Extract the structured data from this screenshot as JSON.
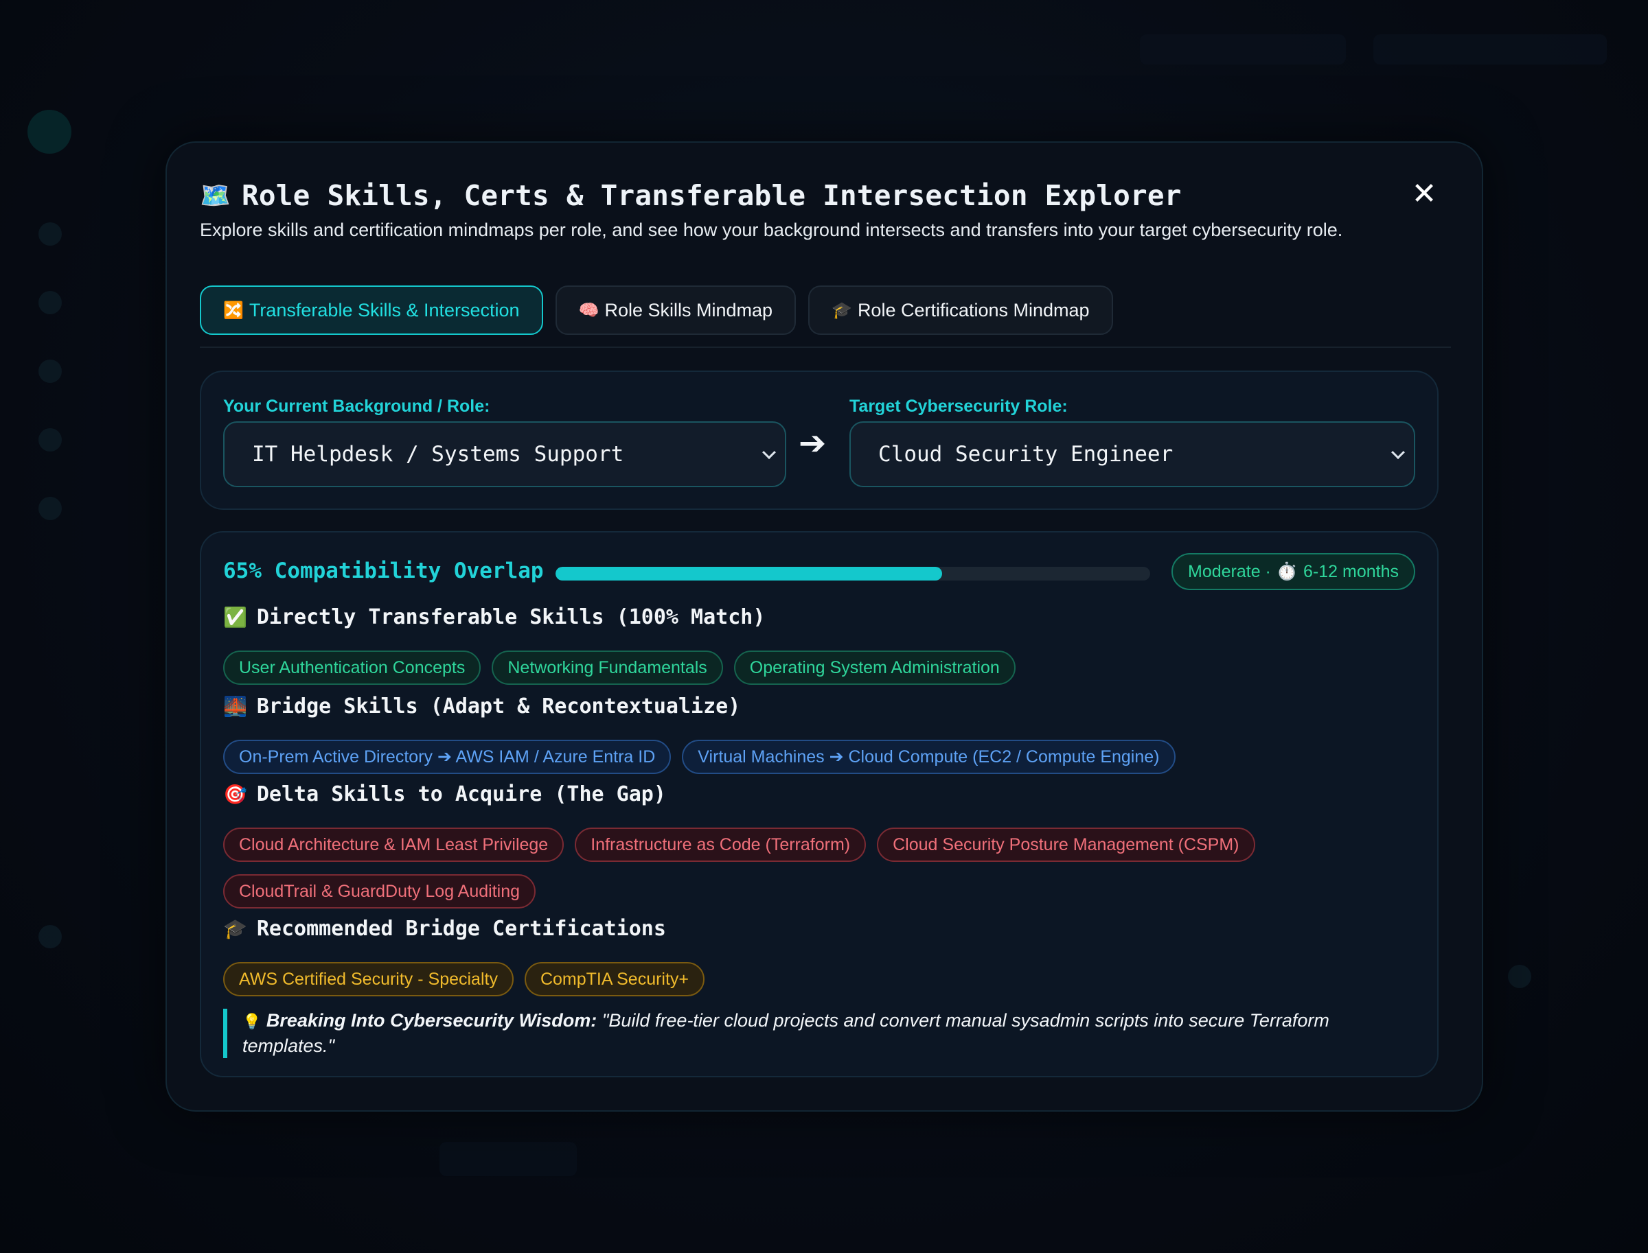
{
  "modal": {
    "title_icon": "🗺️",
    "title": "Role Skills, Certs & Transferable Intersection Explorer",
    "close_label": "✕",
    "subtitle": "Explore skills and certification mindmaps per role, and see how your background intersects and transfers into your target cybersecurity role."
  },
  "tabs": [
    {
      "icon": "🔀",
      "label": "Transferable Skills & Intersection",
      "active": true
    },
    {
      "icon": "🧠",
      "label": "Role Skills Mindmap",
      "active": false
    },
    {
      "icon": "🎓",
      "label": "Role Certifications Mindmap",
      "active": false
    }
  ],
  "selectors": {
    "current_label": "Your Current Background / Role:",
    "current_value": "IT Helpdesk / Systems Support",
    "arrow": "➔",
    "target_label": "Target Cybersecurity Role:",
    "target_value": "Cloud Security Engineer"
  },
  "compatibility": {
    "label": "65% Compatibility Overlap",
    "percent": 65,
    "badge_prefix": "Moderate · ",
    "badge_icon": "⏱️",
    "badge_duration": "6-12 months"
  },
  "sections": {
    "direct": {
      "icon": "✅",
      "title": "Directly Transferable Skills (100% Match)",
      "chips": [
        "User Authentication Concepts",
        "Networking Fundamentals",
        "Operating System Administration"
      ]
    },
    "bridge": {
      "icon": "🌉",
      "title": "Bridge Skills (Adapt & Recontextualize)",
      "chips": [
        "On-Prem Active Directory ➔ AWS IAM / Azure Entra ID",
        "Virtual Machines ➔ Cloud Compute (EC2 / Compute Engine)"
      ]
    },
    "delta": {
      "icon": "🎯",
      "title": "Delta Skills to Acquire (The Gap)",
      "chips_row1": [
        "Cloud Architecture & IAM Least Privilege",
        "Infrastructure as Code (Terraform)",
        "Cloud Security Posture Management (CSPM)"
      ],
      "chips_row2": [
        "CloudTrail & GuardDuty Log Auditing"
      ]
    },
    "certs": {
      "icon": "🎓",
      "title": "Recommended Bridge Certifications",
      "chips": [
        "AWS Certified Security - Specialty",
        "CompTIA Security+"
      ]
    }
  },
  "wisdom": {
    "icon": "💡",
    "heading": "Breaking Into Cybersecurity Wisdom:",
    "quote": "\"Build free-tier cloud projects and convert manual sysadmin scripts into secure Terraform templates.\""
  },
  "colors": {
    "accent": "#14c8cc",
    "green": "#2fd69b",
    "blue": "#5ea2f5",
    "red": "#f0707a",
    "gold": "#f1bb2c"
  }
}
